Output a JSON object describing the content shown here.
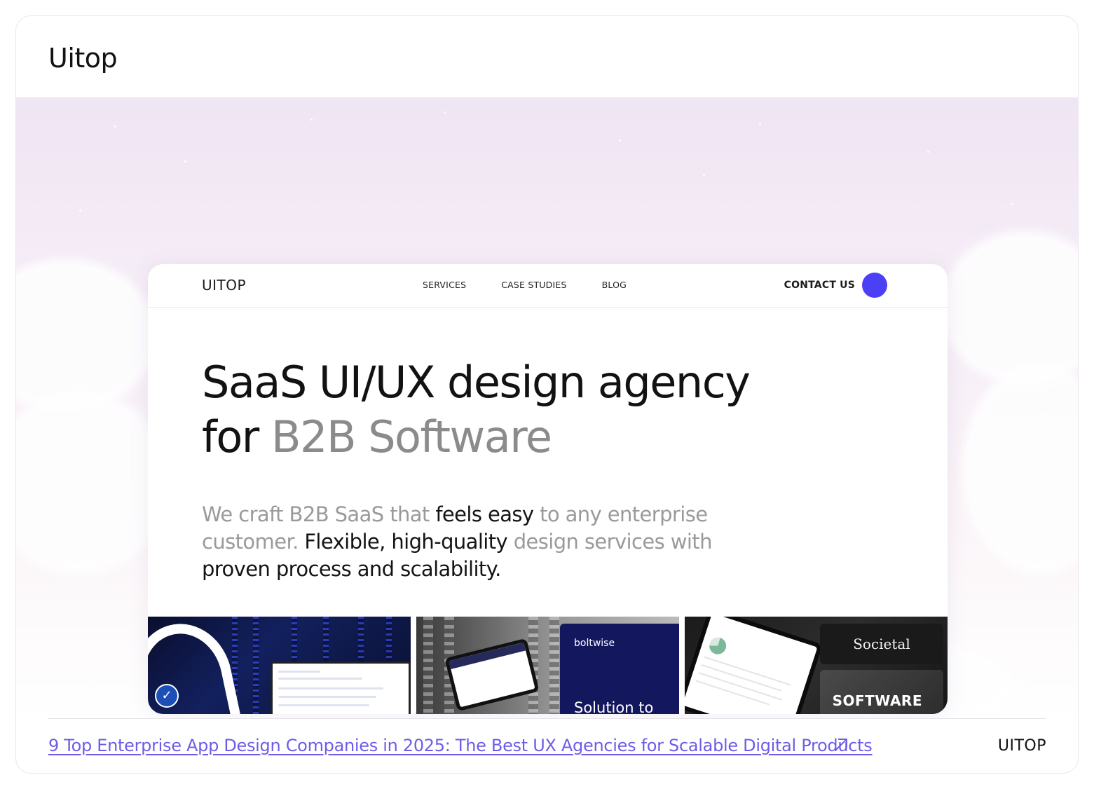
{
  "card": {
    "title": "Uitop"
  },
  "mock": {
    "logo": "UITOP",
    "nav": [
      "SERVICES",
      "CASE STUDIES",
      "BLOG"
    ],
    "contact_label": "CONTACT US",
    "headline": {
      "line1": "SaaS UI/UX design agency",
      "line2_prefix": "for ",
      "line2_muted": "B2B Software"
    },
    "subheadline": [
      {
        "text": "We craft B2B SaaS that ",
        "tone": "muted"
      },
      {
        "text": "feels easy",
        "tone": "dark"
      },
      {
        "text": " to any enterprise customer. ",
        "tone": "muted"
      },
      {
        "text": "Flexible, high-quality",
        "tone": "dark"
      },
      {
        "text": " design services with ",
        "tone": "muted"
      },
      {
        "text": "proven process and scalability.",
        "tone": "dark"
      }
    ],
    "thumbs": {
      "boltwise_brand": "boltwise",
      "boltwise_title": "Solution to",
      "societal_logo": "Societal",
      "societal_caption": "SOFTWARE"
    }
  },
  "footer": {
    "link_text": "9 Top Enterprise App Design Companies in 2025: The Best UX Agencies for Scalable Digital Products",
    "brand": "UITOP"
  },
  "colors": {
    "accent": "#4b40f5",
    "link": "#6d5ce8",
    "muted_text": "#8b8b8b"
  }
}
